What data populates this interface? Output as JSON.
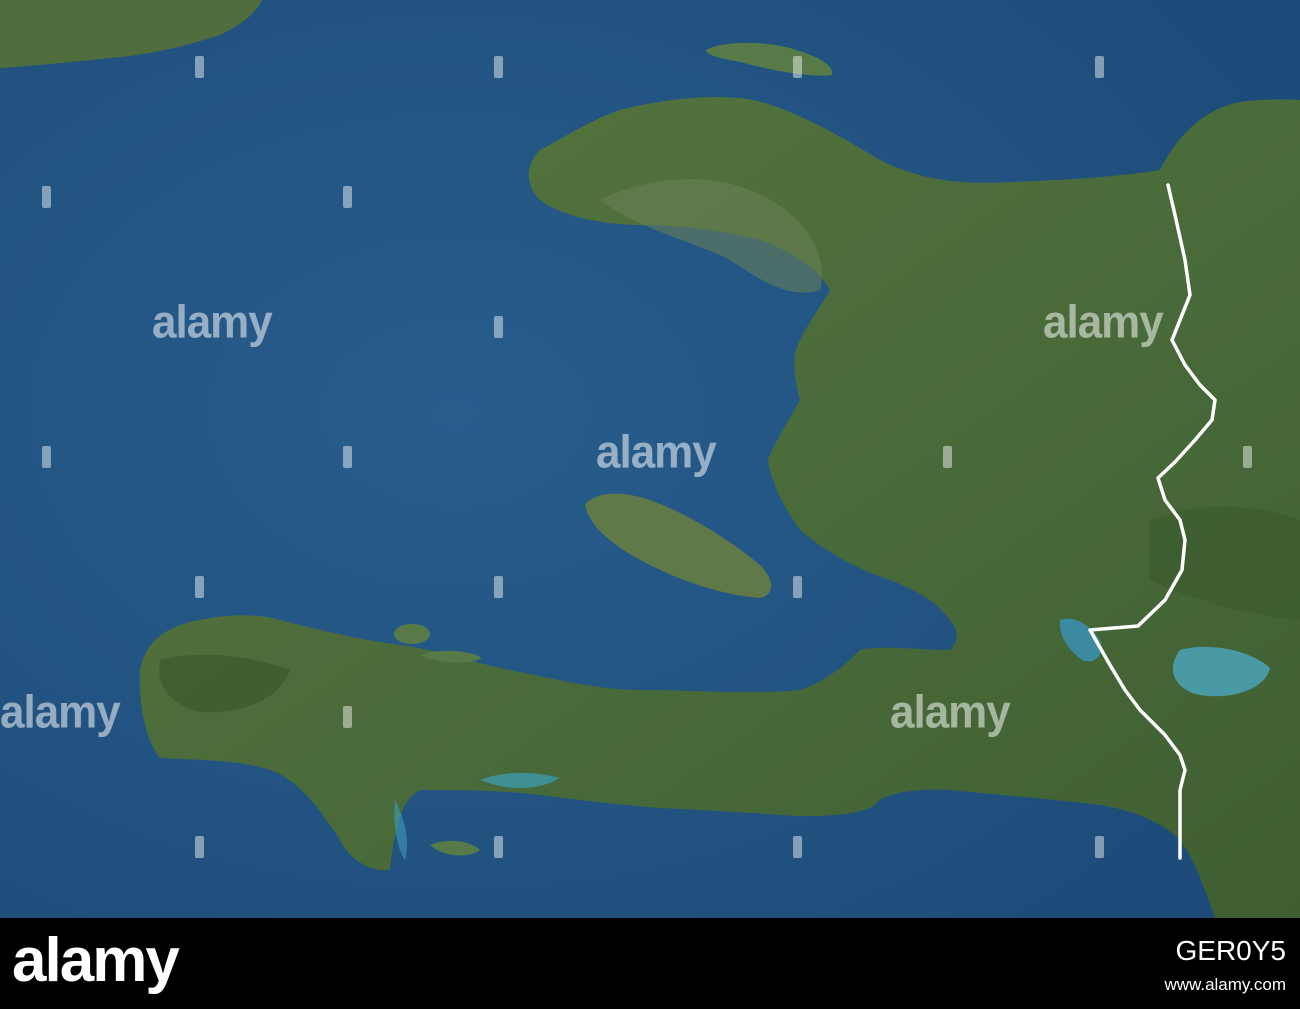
{
  "watermark": {
    "text": "alamy"
  },
  "footer": {
    "logo": "alamy",
    "image_id": "GER0Y5",
    "url": "www.alamy.com"
  },
  "colors": {
    "ocean_deep": "#1f4e7e",
    "ocean_mid": "#275b8a",
    "land_green": "#4d6e3e",
    "land_dark": "#3c5a30",
    "shallow_water": "#3d9fb8",
    "border_line": "#ffffff",
    "footer_bg": "#000000"
  }
}
